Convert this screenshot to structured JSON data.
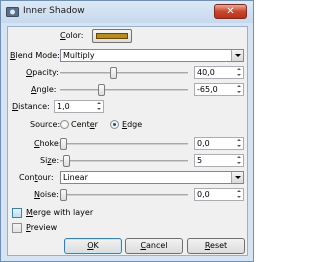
{
  "window": {
    "title": "Inner Shadow",
    "close_glyph": "✕"
  },
  "color": {
    "label": "Color:",
    "mnemonic": "C",
    "rest": "olor:",
    "value": "#b98a1e"
  },
  "blend_mode": {
    "pre": "",
    "mnemonic": "B",
    "rest": "lend Mode:",
    "value": "Multiply"
  },
  "opacity": {
    "mnemonic": "O",
    "rest": "pacity:",
    "value": "40,0",
    "level_percent": 40
  },
  "angle": {
    "mnemonic": "A",
    "rest": "ngle:",
    "value": "-65,0"
  },
  "distance": {
    "mnemonic": "D",
    "rest": "istance:",
    "value": "1,0"
  },
  "source": {
    "label": "Source:",
    "options": [
      {
        "pre": "Cent",
        "mnemonic": "e",
        "rest": "r",
        "selected": false
      },
      {
        "pre": "",
        "mnemonic": "E",
        "rest": "dge",
        "selected": true
      }
    ]
  },
  "choke": {
    "mnemonic": "C",
    "pre": "",
    "rest": "hoke:",
    "value": "0,0"
  },
  "size": {
    "pre": "Si",
    "mnemonic": "z",
    "rest": "e:",
    "value": "5"
  },
  "contour": {
    "pre": "Con",
    "mnemonic": "t",
    "rest": "our:",
    "value": "Linear"
  },
  "noise": {
    "mnemonic": "N",
    "rest": "oise:",
    "value": "0,0"
  },
  "merge": {
    "mnemonic": "M",
    "rest": "erge with layer",
    "checked": false
  },
  "preview": {
    "mnemonic": "P",
    "rest": "review",
    "checked": false
  },
  "buttons": {
    "ok": {
      "mnemonic": "O",
      "rest": "K"
    },
    "cancel": {
      "mnemonic": "C",
      "rest": "ancel"
    },
    "reset": {
      "mnemonic": "R",
      "rest": "eset"
    }
  }
}
